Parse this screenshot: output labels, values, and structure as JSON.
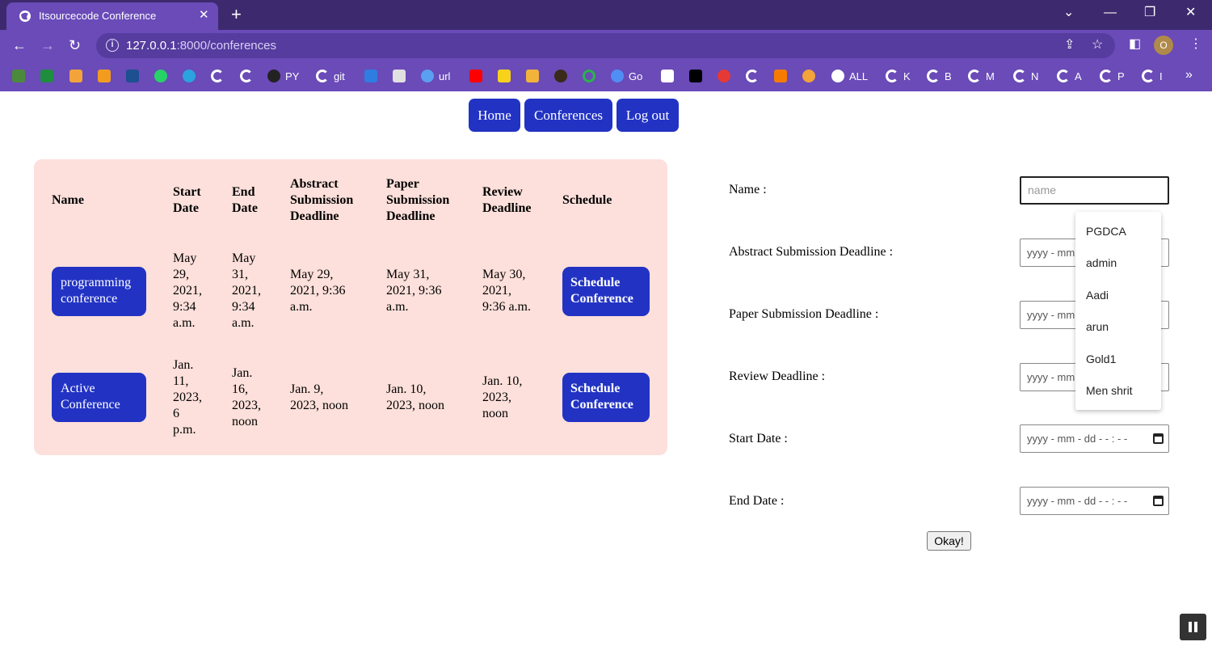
{
  "browser": {
    "tab_title": "Itsourcecode Conference",
    "tab_close": "✕",
    "new_tab": "+",
    "url_host": "127.0.0.1",
    "url_rest": ":8000/conferences",
    "profile_initial": "O",
    "bookmarks": [
      "PY",
      "git",
      "url",
      "Go",
      "ALL",
      "K",
      "B",
      "M",
      "N",
      "A",
      "P",
      "I"
    ],
    "more": "»"
  },
  "nav": {
    "home": "Home",
    "conferences": "Conferences",
    "logout": "Log out"
  },
  "table": {
    "headers": {
      "name": "Name",
      "start1": "Start",
      "start2": "Date",
      "end1": "End",
      "end2": "Date",
      "abs1": "Abstract",
      "abs2": "Submission",
      "abs3": "Deadline",
      "pap1": "Paper",
      "pap2": "Submission",
      "pap3": "Deadline",
      "rev1": "Review",
      "rev2": "Deadline",
      "schedule": "Schedule"
    },
    "rows": [
      {
        "name1": "programming",
        "name2": "conference",
        "start": [
          "May",
          "29,",
          "2021,",
          "9:34",
          "a.m."
        ],
        "end": [
          "May",
          "31,",
          "2021,",
          "9:34",
          "a.m."
        ],
        "abstract": [
          "May 29,",
          "2021, 9:36",
          "a.m."
        ],
        "paper": [
          "May 31,",
          "2021, 9:36",
          "a.m."
        ],
        "review": [
          "May 30,",
          "2021,",
          "9:36 a.m."
        ],
        "sched1": "Schedule",
        "sched2": "Conference"
      },
      {
        "name1": "Active",
        "name2": "Conference",
        "start": [
          "Jan.",
          "11,",
          "2023,",
          "6",
          "p.m."
        ],
        "end": [
          "Jan.",
          "16,",
          "2023,",
          "noon"
        ],
        "abstract": [
          "Jan. 9,",
          "2023, noon"
        ],
        "paper": [
          "Jan. 10,",
          "2023, noon"
        ],
        "review": [
          "Jan. 10,",
          "2023,",
          "noon"
        ],
        "sched1": "Schedule",
        "sched2": "Conference"
      }
    ]
  },
  "form": {
    "name_label": "Name :",
    "name_placeholder": "name",
    "abstract_label": "Abstract Submission Deadline :",
    "paper_label": "Paper Submission Deadline :",
    "review_label": "Review Deadline :",
    "start_label": "Start Date :",
    "end_label": "End Date :",
    "date_partial": "yyyy - mm",
    "date_full": "yyyy - mm - dd   - - : - -",
    "submit": "Okay!"
  },
  "autocomplete": [
    "PGDCA",
    "admin",
    "Aadi",
    "arun",
    "Gold1",
    "Men shrit"
  ]
}
